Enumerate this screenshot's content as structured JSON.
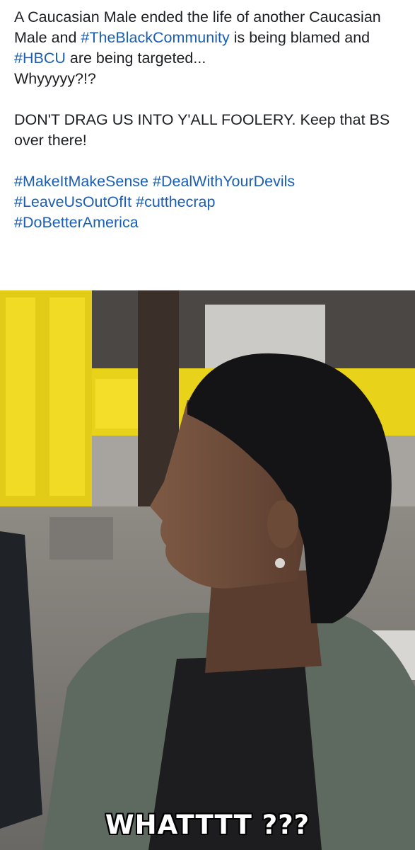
{
  "post": {
    "line1_pre": "A Caucasian Male ended the life of another Caucasian Male and ",
    "hashtag_black_community": "#TheBlackCommunity",
    "line1_mid": " is being blamed and ",
    "hashtag_hbcu": "#HBCU",
    "line1_post": " are being targeted...",
    "why": "Whyyyyy?!?",
    "dont_drag": "DON'T DRAG US INTO Y'ALL FOOLERY. Keep that BS over there!",
    "hashtags": [
      "#MakeItMakeSense",
      "#DealWithYourDevils",
      "#LeaveUsOutOfIt",
      "#cutthecrap",
      "#DoBetterAmerica"
    ]
  },
  "media": {
    "caption": "WHATTTT ???"
  },
  "colors": {
    "text": "#1c1e21",
    "hashtag": "#1a5fb4",
    "background": "#ffffff"
  }
}
